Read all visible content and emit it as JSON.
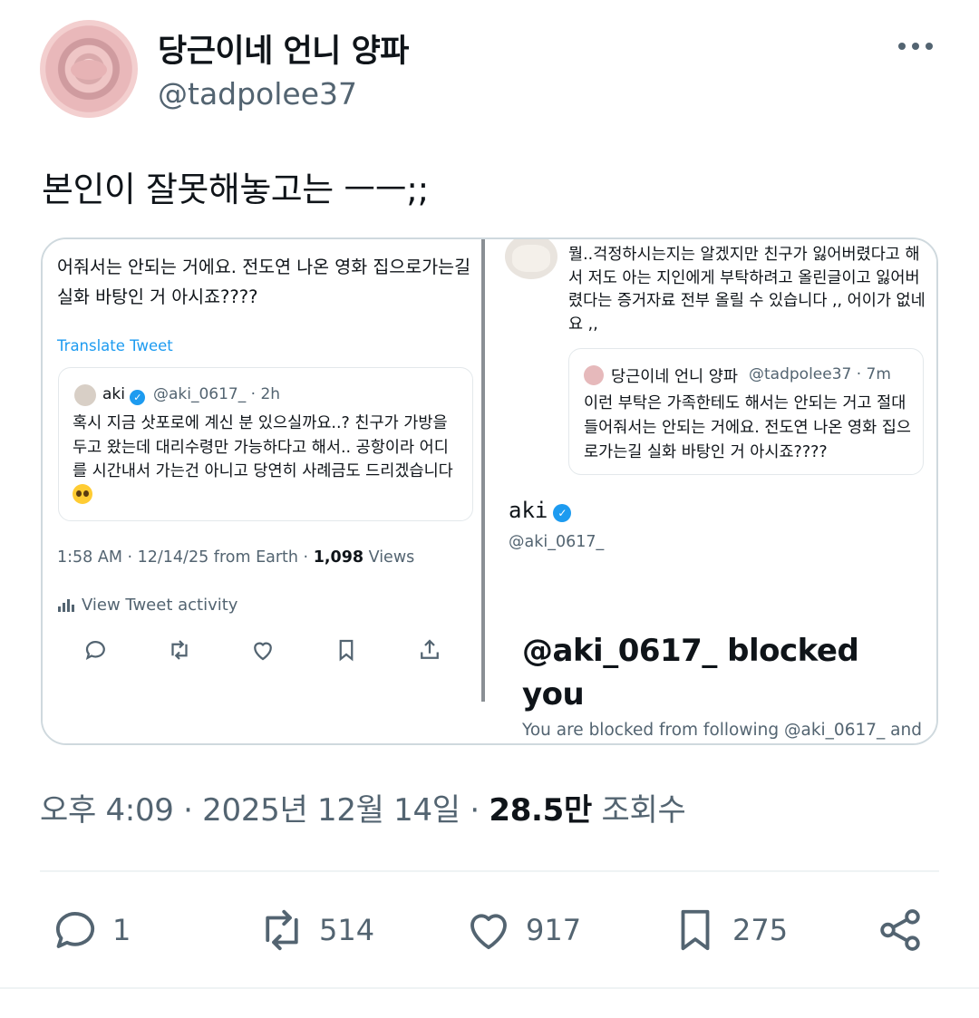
{
  "author": {
    "display_name": "당근이네 언니 양파",
    "handle": "@tadpolee37"
  },
  "tweet": {
    "text": "본인이 잘못해놓고는 ㅡㅡ;;",
    "timestamp_time": "오후 4:09",
    "timestamp_sep1": "·",
    "timestamp_date": "2025년 12월 14일",
    "timestamp_sep2": "·",
    "views_count": "28.5만",
    "views_label": "조회수"
  },
  "media": {
    "left": {
      "text": "어줘서는 안되는 거에요. 전도연 나온 영화 집으로가는길 실화 바탕인 거 아시죠????",
      "translate": "Translate Tweet",
      "quote": {
        "name": "aki",
        "meta": "@aki_0617_ · 2h",
        "body": "혹시 지금 삿포로에 계신 분 있으실까요..? 친구가 가방을 두고 왔는데 대리수령만 가능하다고 해서.. 공항이라 어디를 시간내서 가는건 아니고 당연히 사례금도 드리겠습니다"
      },
      "time": "1:58 AM · 12/14/25 from Earth · ",
      "views_count": "1,098",
      "views_label": " Views",
      "activity": "View Tweet activity",
      "icons": [
        "reply-icon",
        "retweet-icon",
        "like-icon",
        "bookmark-icon",
        "share-icon"
      ]
    },
    "right": {
      "text": "뭘..걱정하시는지는 알겠지만 친구가 잃어버렸다고 해서 저도 아는 지인에게 부탁하려고 올린글이고 잃어버렸다는 증거자료 전부 올릴 수 있습니다 ,, 어이가 없네요 ,,",
      "quote": {
        "name": "당근이네 언니 양파",
        "handle": "@tadpolee37 · 7m",
        "body": "이런 부탁은 가족한테도 해서는 안되는 거고 절대 들어줘서는 안되는 거에요. 전도연 나온 영화 집으로가는길 실화 바탕인 거 아시죠????"
      },
      "profile_name": "aki",
      "profile_handle": "@aki_0617_",
      "blocked_title": "@aki_0617_ blocked you",
      "blocked_sub": "You are blocked from following @aki_0617_ and"
    }
  },
  "actions": {
    "reply": "1",
    "retweet": "514",
    "like": "917",
    "bookmark": "275"
  },
  "colors": {
    "text": "#0f1419",
    "secondary": "#536471",
    "accent": "#1d9bf0",
    "border": "#cfd9de"
  }
}
